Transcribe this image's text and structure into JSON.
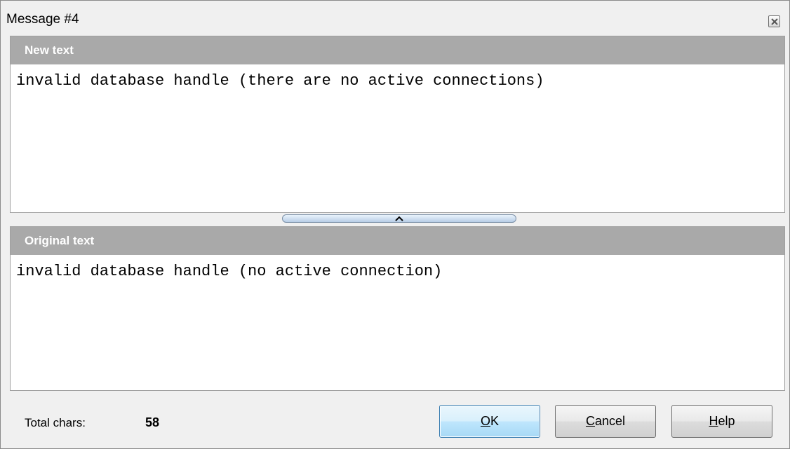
{
  "window": {
    "title": "Message #4"
  },
  "new_text_pane": {
    "header": "New text",
    "content": "invalid database handle (there are no active connections)"
  },
  "original_text_pane": {
    "header": "Original text",
    "content": "invalid database handle (no active connection)"
  },
  "footer": {
    "total_chars_label": "Total chars:",
    "total_chars_value": "58"
  },
  "buttons": {
    "ok": {
      "mnemonic": "O",
      "rest": "K"
    },
    "cancel": {
      "mnemonic": "C",
      "rest": "ancel"
    },
    "help": {
      "mnemonic": "H",
      "rest": "elp"
    }
  },
  "icons": {
    "close": "close-icon",
    "splitter": "chevron-up-icon"
  }
}
